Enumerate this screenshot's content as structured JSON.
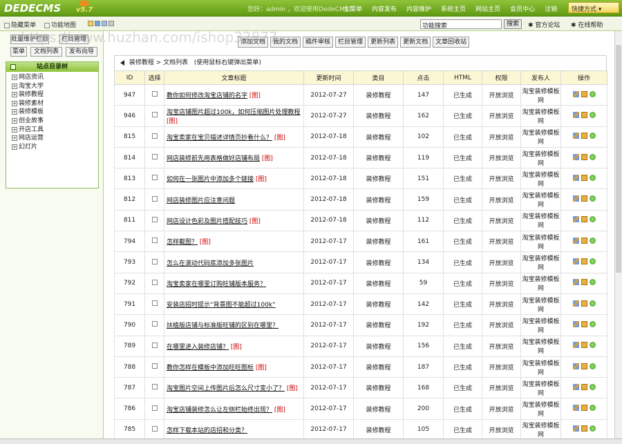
{
  "header": {
    "logo": "DEDECMS",
    "version": "v5.7",
    "welcome": "您好：admin ，欢迎使用DedeCMS！",
    "nav": [
      "主菜单",
      "内容发布",
      "内容维护",
      "系统主页",
      "网站主页",
      "会员中心",
      "注销"
    ],
    "quick": "快捷方式"
  },
  "toolbar2": {
    "hide_menu": "隐藏菜单",
    "site_map": "功能地图",
    "search_value": "功能搜索",
    "search_btn": "搜索",
    "forum": "官方论坛",
    "help": "在线帮助"
  },
  "left": {
    "buttons": [
      "批量维护栏目",
      "栏目管理",
      "菜单",
      "文档列表",
      "发布向导"
    ],
    "tree_title": "站点目录树",
    "tree_items": [
      "网店资讯",
      "淘宝大学",
      "装修教程",
      "装修素材",
      "装修模板",
      "创业故事",
      "开店工具",
      "网店运营",
      "幻灯片"
    ]
  },
  "main": {
    "actions": [
      "添加文档",
      "我的文档",
      "稿件审核",
      "栏目管理",
      "更新列表",
      "更新文档",
      "文章回收站"
    ],
    "breadcrumb_a": "装修教程",
    "breadcrumb_b": "文档列表",
    "breadcrumb_hint": "(使用鼠标右键弹出菜单)",
    "columns": [
      "ID",
      "选择",
      "文章标题",
      "更新时间",
      "类目",
      "点击",
      "HTML",
      "权限",
      "发布人",
      "操作"
    ],
    "rows": [
      {
        "id": "947",
        "title": "教你如何修改淘宝店铺的名字",
        "pic": "[图]",
        "date": "2012-07-27",
        "cat": "装修教程",
        "clicks": "147",
        "html": "已生成",
        "perm": "开放浏览",
        "pub": "淘宝装修模板网"
      },
      {
        "id": "946",
        "title": "淘宝店铺图片超过100k，如何压缩图片处理教程",
        "pic": "[图]",
        "date": "2012-07-27",
        "cat": "装修教程",
        "clicks": "162",
        "html": "已生成",
        "perm": "开放浏览",
        "pub": "淘宝装修模板网"
      },
      {
        "id": "815",
        "title": "淘宝卖家在宝贝描述详情页抄看什么？",
        "pic": "[图]",
        "date": "2012-07-18",
        "cat": "装修教程",
        "clicks": "102",
        "html": "已生成",
        "perm": "开放浏览",
        "pub": "淘宝装修模板网"
      },
      {
        "id": "814",
        "title": "网店装修前先用表格做好店铺布局",
        "pic": "[图]",
        "date": "2012-07-18",
        "cat": "装修教程",
        "clicks": "119",
        "html": "已生成",
        "perm": "开放浏览",
        "pub": "淘宝装修模板网"
      },
      {
        "id": "813",
        "title": "如何在一张图片中添加多个链接",
        "pic": "[图]",
        "date": "2012-07-18",
        "cat": "装修教程",
        "clicks": "151",
        "html": "已生成",
        "perm": "开放浏览",
        "pub": "淘宝装修模板网"
      },
      {
        "id": "812",
        "title": "网店装修图片应注意问题",
        "pic": "",
        "date": "2012-07-18",
        "cat": "装修教程",
        "clicks": "159",
        "html": "已生成",
        "perm": "开放浏览",
        "pub": "淘宝装修模板网"
      },
      {
        "id": "811",
        "title": "网店设计色彩及图片搭配技巧",
        "pic": "[图]",
        "date": "2012-07-18",
        "cat": "装修教程",
        "clicks": "112",
        "html": "已生成",
        "perm": "开放浏览",
        "pub": "淘宝装修模板网"
      },
      {
        "id": "794",
        "title": "怎样截图？",
        "pic": "[图]",
        "date": "2012-07-17",
        "cat": "装修教程",
        "clicks": "161",
        "html": "已生成",
        "perm": "开放浏览",
        "pub": "淘宝装修模板网"
      },
      {
        "id": "793",
        "title": "怎么在滚动代码底添加多张图片",
        "pic": "",
        "date": "2012-07-17",
        "cat": "装修教程",
        "clicks": "134",
        "html": "已生成",
        "perm": "开放浏览",
        "pub": "淘宝装修模板网"
      },
      {
        "id": "792",
        "title": "淘宝卖家在哪里订购旺铺版本服务？",
        "pic": "",
        "date": "2012-07-17",
        "cat": "装修教程",
        "clicks": "59",
        "html": "已生成",
        "perm": "开放浏览",
        "pub": "淘宝装修模板网"
      },
      {
        "id": "791",
        "title": "安装店招时提示“背景图不能超过100k”",
        "pic": "",
        "date": "2012-07-17",
        "cat": "装修教程",
        "clicks": "142",
        "html": "已生成",
        "perm": "开放浏览",
        "pub": "淘宝装修模板网"
      },
      {
        "id": "790",
        "title": "扶植版店铺与标准版旺铺的区别在哪里？",
        "pic": "",
        "date": "2012-07-17",
        "cat": "装修教程",
        "clicks": "192",
        "html": "已生成",
        "perm": "开放浏览",
        "pub": "淘宝装修模板网"
      },
      {
        "id": "789",
        "title": "在哪里进入装修店铺？",
        "pic": "[图]",
        "date": "2012-07-17",
        "cat": "装修教程",
        "clicks": "156",
        "html": "已生成",
        "perm": "开放浏览",
        "pub": "淘宝装修模板网"
      },
      {
        "id": "788",
        "title": "教你怎样在模板中添加旺旺图标",
        "pic": "[图]",
        "date": "2012-07-17",
        "cat": "装修教程",
        "clicks": "187",
        "html": "已生成",
        "perm": "开放浏览",
        "pub": "淘宝装修模板网"
      },
      {
        "id": "787",
        "title": "淘宝图片空间上传图片后怎么尺寸变小了？",
        "pic": "[图]",
        "date": "2012-07-17",
        "cat": "装修教程",
        "clicks": "168",
        "html": "已生成",
        "perm": "开放浏览",
        "pub": "淘宝装修模板网"
      },
      {
        "id": "786",
        "title": "淘宝店铺装修怎么让左侧栏始终出现？",
        "pic": "[图]",
        "date": "2012-07-17",
        "cat": "装修教程",
        "clicks": "200",
        "html": "已生成",
        "perm": "开放浏览",
        "pub": "淘宝装修模板网"
      },
      {
        "id": "785",
        "title": "怎样下载本站的店招和分类？",
        "pic": "",
        "date": "2012-07-17",
        "cat": "装修教程",
        "clicks": "105",
        "html": "已生成",
        "perm": "开放浏览",
        "pub": "淘宝装修模板网"
      }
    ]
  },
  "watermark": "https://www.huzhan.com/ishop32877",
  "colors": {
    "header_green": "#6aa81a",
    "pic_red": "#cc0000",
    "th_bg": "#fbf7d4"
  }
}
